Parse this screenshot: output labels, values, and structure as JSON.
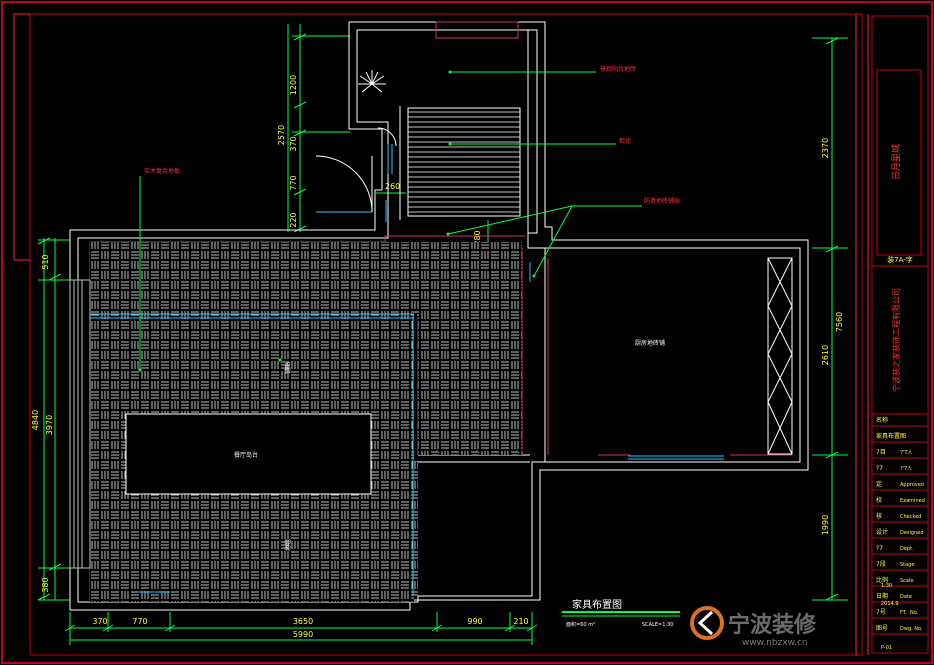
{
  "drawing": {
    "title": "家具布置图",
    "area_note": "面积=60 m²",
    "scale_note": "SCALE=1:30",
    "watermark": {
      "brand": "宁波装修",
      "url": "www.nbzxw.cn"
    }
  },
  "labels": {
    "balcony_left": "景观阳台地砖",
    "bathroom": "防滑地砖铺贴",
    "cabinet": "柜组",
    "door_note": "实木复合地板",
    "kitchen": "厨房地砖铺",
    "island": "餐厅岛台",
    "bed_label": "铺贴",
    "bed_label2": "地毯",
    "room_dim_1200": "1200"
  },
  "dims": {
    "top_1200": "1200",
    "top_2570": "2570",
    "top_370": "370",
    "top_770": "770",
    "top_220": "220",
    "d260": "260",
    "d280": "280",
    "left_510": "510",
    "left_4840": "4840",
    "left_3970": "3970",
    "left_380": "380",
    "right_2370": "2370",
    "right_7560": "7560",
    "right_2610": "2610",
    "right_1990": "1990",
    "bottom_370": "370",
    "bottom_770": "770",
    "bottom_3650": "3650",
    "bottom_990": "990",
    "bottom_210": "210",
    "bottom_5990": "5990"
  },
  "title_block": {
    "project_name": "日月星城",
    "sheet_code": "装7A-字",
    "company": "宁波装之家装饰工程有限公司",
    "rows": [
      {
        "cn": "名称",
        "en": ""
      },
      {
        "cn": "家具布置图",
        "en": ""
      },
      {
        "cn": "7目",
        "en": "7'T人"
      },
      {
        "cn": "?7",
        "en": "?'7人"
      },
      {
        "cn": "定",
        "en": "Approved"
      },
      {
        "cn": "校",
        "en": "Examined"
      },
      {
        "cn": "核",
        "en": "Checked"
      },
      {
        "cn": "设计",
        "en": "Designed"
      },
      {
        "cn": "?7",
        "en": "Dept."
      },
      {
        "cn": "7段",
        "en": "Stage"
      },
      {
        "cn": "比例",
        "en": "Scale"
      },
      {
        "cn": "日期",
        "en": "Date"
      },
      {
        "cn": "7号",
        "en": "FT. .No."
      },
      {
        "cn": "图号",
        "en": "Dwg. No."
      }
    ],
    "scale_value": "1:30",
    "date_value": "2014.9",
    "page": "P-01"
  },
  "colors": {
    "wall": "#ffffff",
    "frame": "#c0001a",
    "dim": "#00ff44",
    "text": "#ffff33",
    "label_red": "#ff3040",
    "window": "#20c8ff",
    "door": "#ff3060",
    "floor": "#bfbfbf"
  }
}
